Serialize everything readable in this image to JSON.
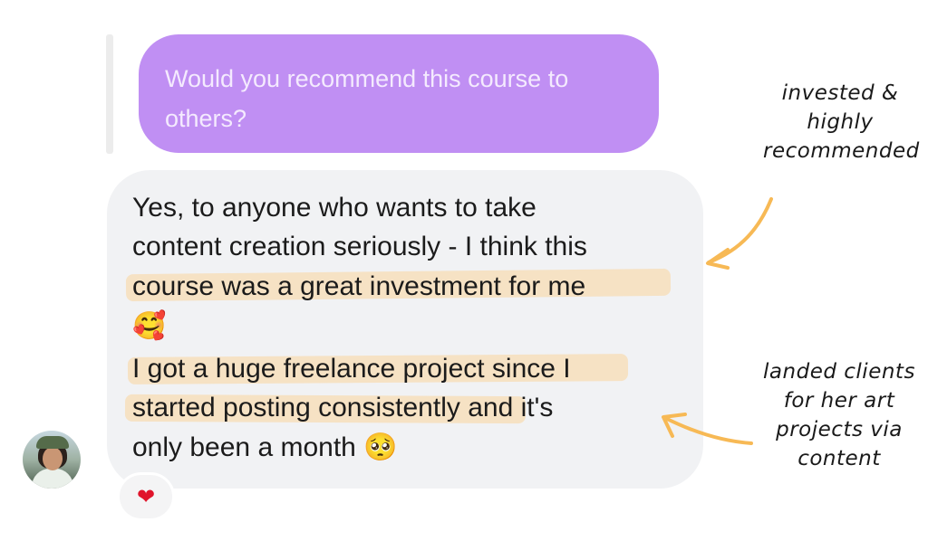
{
  "quoted_message": {
    "lines": [
      "Would you recommend this course to",
      "others?"
    ]
  },
  "reply_message": {
    "line1": "Yes, to anyone who wants to take",
    "line2": "content creation seriously - I think this",
    "line3": "course was a great investment for me",
    "line4_emoji": "🥰",
    "line5_a": "I got a huge freelance project since",
    "line5_b": " I",
    "line6_a": "started posting consistently",
    "line6_b": " and it's",
    "line7_text": "only been a month ",
    "line7_emoji": "🥺"
  },
  "reaction": {
    "emoji": "❤"
  },
  "annotations": {
    "top": [
      "invested &",
      "highly",
      "recommended"
    ],
    "bottom": [
      "landed clients",
      "for her art",
      "projects via",
      "content"
    ]
  },
  "colors": {
    "quoted_bubble": "#c08ff3",
    "reply_bubble": "#f1f2f4",
    "highlight": "#f7ddb8",
    "arrow": "#f7b955"
  },
  "icons": {
    "avatar": "user-avatar-photo",
    "reaction": "heart-icon"
  }
}
